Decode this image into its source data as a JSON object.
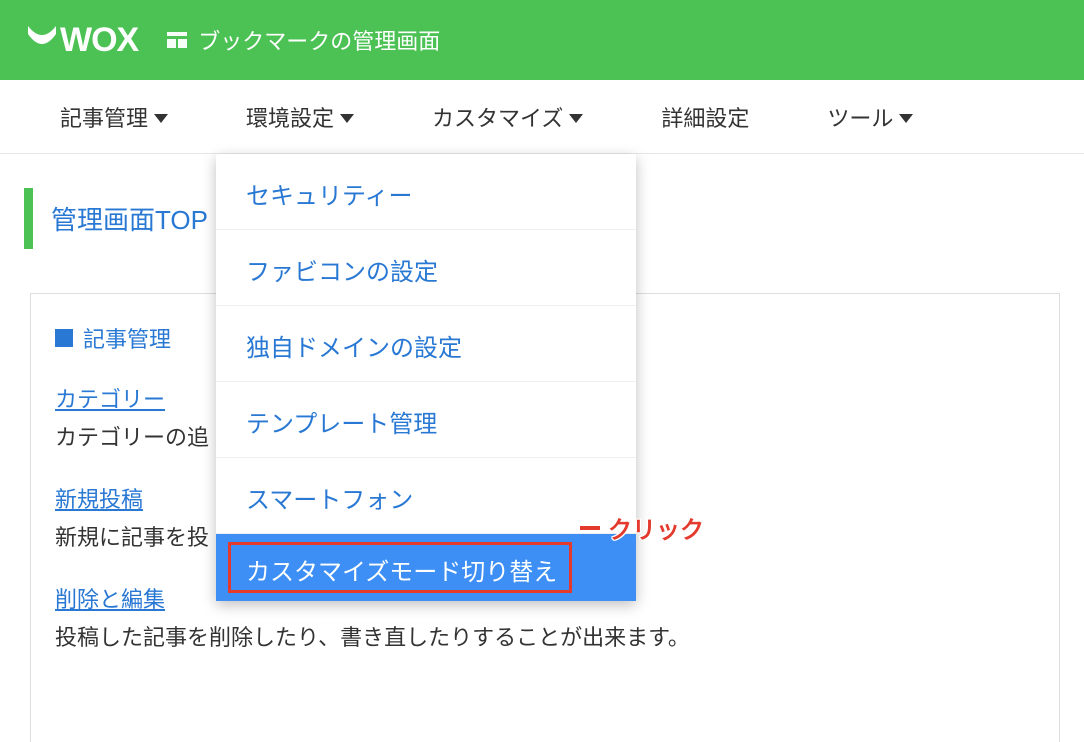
{
  "brand": {
    "name": "WOX"
  },
  "header": {
    "title": "ブックマークの管理画面"
  },
  "nav": {
    "items": [
      {
        "label": "記事管理",
        "has_caret": true
      },
      {
        "label": "環境設定",
        "has_caret": true
      },
      {
        "label": "カスタマイズ",
        "has_caret": true
      },
      {
        "label": "詳細設定",
        "has_caret": false
      },
      {
        "label": "ツール",
        "has_caret": true
      }
    ]
  },
  "page": {
    "heading": "管理画面TOP"
  },
  "section": {
    "title": "記事管理",
    "items": [
      {
        "link": "カテゴリー",
        "desc": "カテゴリーの追"
      },
      {
        "link": "新規投稿",
        "desc": "新規に記事を投"
      },
      {
        "link": "削除と編集",
        "desc": "投稿した記事を削除したり、書き直したりすることが出来ます。"
      }
    ]
  },
  "dropdown": {
    "items": [
      "セキュリティー",
      "ファビコンの設定",
      "独自ドメインの設定",
      "テンプレート管理",
      "スマートフォン",
      "カスタマイズモード切り替え"
    ],
    "highlighted_index": 5
  },
  "annotation": {
    "label": "クリック"
  }
}
